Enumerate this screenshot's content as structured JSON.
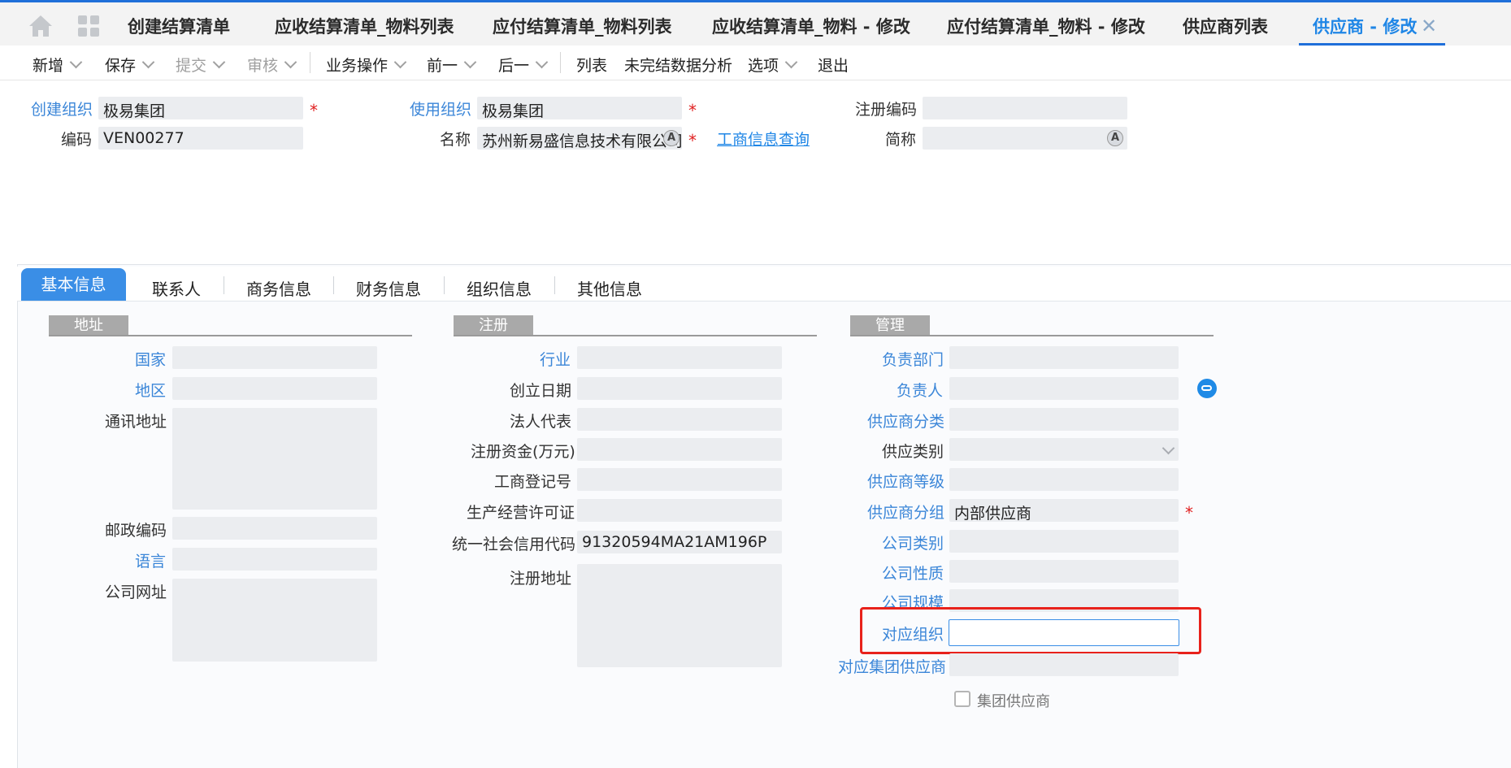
{
  "tabs": [
    {
      "label": "创建结算清单"
    },
    {
      "label": "应收结算清单_物料列表"
    },
    {
      "label": "应付结算清单_物料列表"
    },
    {
      "label": "应收结算清单_物料 - 修改"
    },
    {
      "label": "应付结算清单_物料 - 修改"
    },
    {
      "label": "供应商列表"
    },
    {
      "label": "供应商 - 修改"
    }
  ],
  "toolbar": {
    "new": "新增",
    "save": "保存",
    "submit": "提交",
    "audit": "审核",
    "business_ops": "业务操作",
    "prev": "前一",
    "next": "后一",
    "list": "列表",
    "unfinished_analysis": "未完结数据分析",
    "options": "选项",
    "exit": "退出"
  },
  "header": {
    "create_org_label": "创建组织",
    "create_org_value": "极易集团",
    "use_org_label": "使用组织",
    "use_org_value": "极易集团",
    "reg_code_label": "注册编码",
    "reg_code_value": "",
    "code_label": "编码",
    "code_value": "VEN00277",
    "name_label": "名称",
    "name_value": "苏州新易盛信息技术有限公司",
    "biz_query_link": "工商信息查询",
    "short_name_label": "简称",
    "short_name_value": ""
  },
  "subtabs": [
    {
      "label": "基本信息"
    },
    {
      "label": "联系人"
    },
    {
      "label": "商务信息"
    },
    {
      "label": "财务信息"
    },
    {
      "label": "组织信息"
    },
    {
      "label": "其他信息"
    }
  ],
  "address": {
    "title": "地址",
    "country_label": "国家",
    "region_label": "地区",
    "mail_address_label": "通讯地址",
    "postcode_label": "邮政编码",
    "language_label": "语言",
    "website_label": "公司网址"
  },
  "registration": {
    "title": "注册",
    "industry_label": "行业",
    "founded_label": "创立日期",
    "legal_rep_label": "法人代表",
    "capital_label": "注册资金(万元)",
    "biz_reg_no_label": "工商登记号",
    "license_label": "生产经营许可证",
    "credit_code_label": "统一社会信用代码",
    "credit_code_value": "91320594MA21AM196P",
    "reg_address_label": "注册地址"
  },
  "management": {
    "title": "管理",
    "dept_label": "负责部门",
    "owner_label": "负责人",
    "category_label": "供应商分类",
    "type_label": "供应类别",
    "grade_label": "供应商等级",
    "group_label": "供应商分组",
    "group_value": "内部供应商",
    "company_type_label": "公司类别",
    "company_nature_label": "公司性质",
    "company_scale_label": "公司规模",
    "corresponding_org_label": "对应组织",
    "corresponding_org_value": "",
    "group_supplier_ref_label": "对应集团供应商",
    "group_supplier_checkbox_label": "集团供应商"
  },
  "colors": {
    "accent": "#1f86e6",
    "highlight": "#e8221b",
    "section_header": "#a9a9a9"
  }
}
